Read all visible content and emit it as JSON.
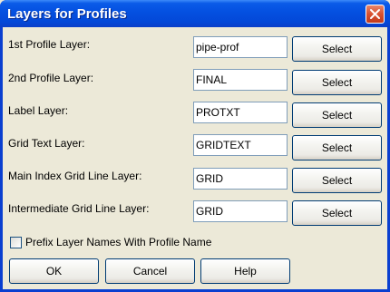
{
  "window": {
    "title": "Layers for Profiles"
  },
  "rows": [
    {
      "label": "1st Profile Layer:",
      "value": "pipe-prof",
      "button": "Select"
    },
    {
      "label": "2nd Profile Layer:",
      "value": "FINAL",
      "button": "Select"
    },
    {
      "label": "Label Layer:",
      "value": "PROTXT",
      "button": "Select"
    },
    {
      "label": "Grid Text Layer:",
      "value": "GRIDTEXT",
      "button": "Select"
    },
    {
      "label": "Main Index Grid Line Layer:",
      "value": "GRID",
      "button": "Select"
    },
    {
      "label": "Intermediate Grid Line Layer:",
      "value": "GRID",
      "button": "Select"
    }
  ],
  "prefix_checkbox": {
    "label": "Prefix Layer Names With Profile Name",
    "checked": false
  },
  "footer": {
    "ok_label": "OK",
    "cancel_label": "Cancel",
    "help_label": "Help"
  },
  "colors": {
    "title_bar": "#0450E0",
    "close_button": "#D8502F",
    "dialog_bg": "#ECE9D8",
    "field_border": "#7F9DB9",
    "button_border": "#003C74"
  },
  "icons": {
    "close": "close-icon"
  }
}
